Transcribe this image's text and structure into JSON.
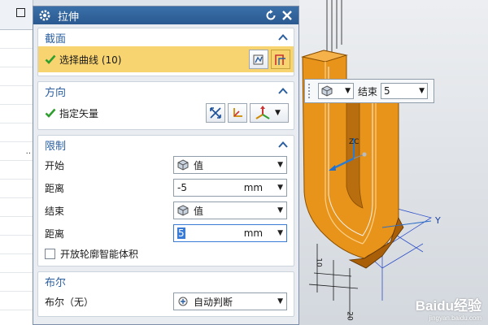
{
  "dialog": {
    "title": "拉伸"
  },
  "sections": {
    "section": {
      "label": "截面",
      "select_label": "选择曲线 (10)"
    },
    "direction": {
      "label": "方向",
      "vector_label": "指定矢量"
    },
    "limits": {
      "label": "限制",
      "start_label": "开始",
      "start_value": "值",
      "start_distance_label": "距离",
      "start_distance": "-5",
      "start_unit": "mm",
      "end_label": "结束",
      "end_value": "值",
      "end_distance_label": "距离",
      "end_distance": "5",
      "end_unit": "mm",
      "open_profile_label": "开放轮廓智能体积"
    },
    "boolean": {
      "label": "布尔",
      "op_label": "布尔（无）",
      "op_value": "自动判断"
    }
  },
  "viewport": {
    "float_label": "结束",
    "float_value": "5",
    "axis_z": "ZC",
    "axis_y": "Y",
    "dim_10": "10",
    "dim_20": "20"
  },
  "watermark": {
    "brand": "Baidu经验",
    "url": "jingyan.baidu.com"
  },
  "colors": {
    "title_bar": "#2a5a90",
    "section_label": "#2b5fa0",
    "highlight": "#f7d470",
    "check": "#2e9e2e",
    "part_orange": "#e8941a"
  },
  "icons": {
    "titlebar": [
      "gear-icon",
      "reset-icon",
      "close-icon"
    ],
    "section": [
      "sketch-section-icon",
      "curve-select-icon"
    ],
    "direction": [
      "reverse-direction-icon",
      "vector-dialog-icon",
      "vector-csys-icon"
    ]
  }
}
